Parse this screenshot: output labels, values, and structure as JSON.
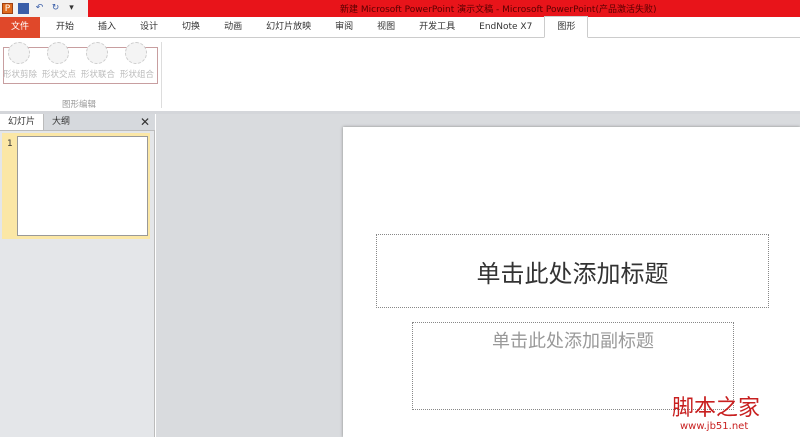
{
  "window": {
    "title": "新建 Microsoft PowerPoint 演示文稿 - Microsoft PowerPoint(产品激活失败)"
  },
  "qat": {
    "app_icon": "P",
    "icons": [
      "save-icon",
      "undo-icon",
      "redo-icon",
      "customize-icon"
    ]
  },
  "tabs": [
    {
      "label": "文件"
    },
    {
      "label": "开始"
    },
    {
      "label": "插入"
    },
    {
      "label": "设计"
    },
    {
      "label": "切换"
    },
    {
      "label": "动画"
    },
    {
      "label": "幻灯片放映"
    },
    {
      "label": "审阅"
    },
    {
      "label": "视图"
    },
    {
      "label": "开发工具"
    },
    {
      "label": "EndNote X7"
    },
    {
      "label": "图形"
    }
  ],
  "ribbon": {
    "buttons": [
      {
        "label": "形状剪除"
      },
      {
        "label": "形状交点"
      },
      {
        "label": "形状联合"
      },
      {
        "label": "形状组合"
      }
    ],
    "group_label": "图形编辑"
  },
  "pane": {
    "tabs": [
      {
        "label": "幻灯片"
      },
      {
        "label": "大纲"
      }
    ],
    "close": "✕",
    "slide_number": "1"
  },
  "slide": {
    "title_placeholder": "单击此处添加标题",
    "subtitle_placeholder": "单击此处添加副标题"
  },
  "watermark": {
    "text": "脚本之家",
    "url": "www.jb51.net"
  }
}
